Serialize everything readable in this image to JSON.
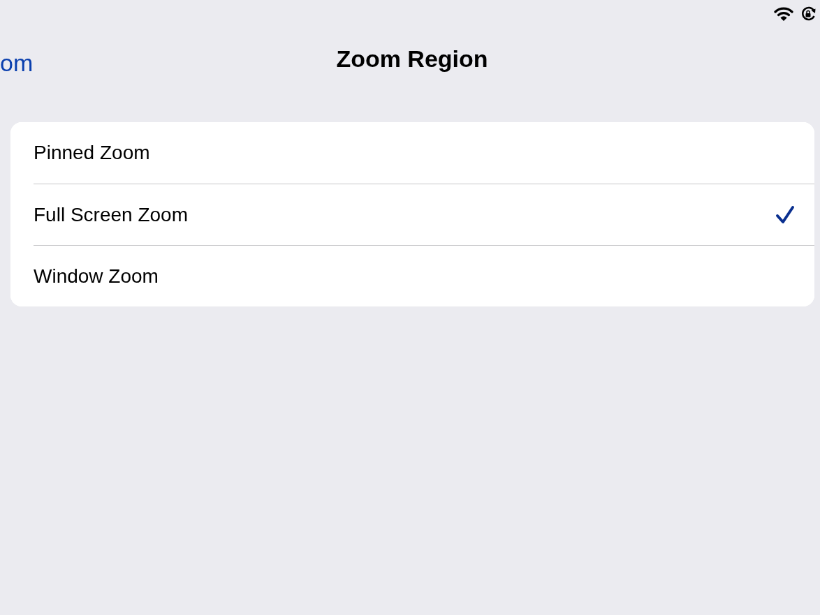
{
  "nav": {
    "back_label": "om",
    "title": "Zoom Region"
  },
  "options": [
    {
      "label": "Pinned Zoom",
      "selected": false
    },
    {
      "label": "Full Screen Zoom",
      "selected": true
    },
    {
      "label": "Window Zoom",
      "selected": false
    }
  ]
}
